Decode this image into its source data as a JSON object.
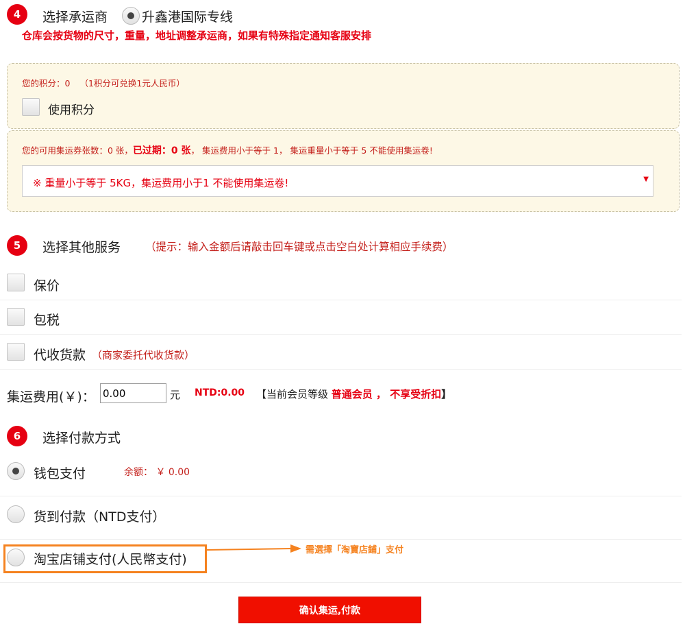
{
  "step4": {
    "number": "4",
    "title": "选择承运商",
    "carrier_option": "升鑫港国际专线",
    "warning": "仓库会按货物的尺寸，重量，地址调整承运商，如果有特殊指定通知客服安排"
  },
  "points": {
    "label": "您的积分：0",
    "rule": "（1积分可兑换1元人民币）",
    "use_label": "使用积分"
  },
  "coupons": {
    "prefix": "您的可用集运券张数：0 张，",
    "expired": "已过期：0 张",
    "suffix": "，  集运费用小于等于 1，  集运重量小于等于 5 不能使用集运卷!",
    "select_value": "※ 重量小于等于 5KG，集运费用小于1 不能使用集运卷!"
  },
  "step5": {
    "number": "5",
    "title": "选择其他服务",
    "hint": "（提示：输入金额后请敲击回车键或点击空白处计算相应手续费）",
    "services": [
      {
        "label": "保价",
        "note": ""
      },
      {
        "label": "包税",
        "note": ""
      },
      {
        "label": "代收货款",
        "note": "（商家委托代收货款）"
      }
    ]
  },
  "fee": {
    "label": "集运费用(￥)：",
    "value": "0.00",
    "unit": "元",
    "ntd": "NTD:0.00",
    "member_prefix": "【当前会员等级 ",
    "member_level": "普通会员 ，",
    "member_discount": " 不享受折扣",
    "member_suffix": "】"
  },
  "step6": {
    "number": "6",
    "title": "选择付款方式",
    "wallet": {
      "label": "钱包支付",
      "balance": "余额： ￥ 0.00",
      "selected": true
    },
    "cod": {
      "label": "货到付款（NTD支付）",
      "selected": false
    },
    "taobao": {
      "label": "淘宝店铺支付(人民幣支付)",
      "selected": false
    },
    "annotation": "需選擇「淘寶店鋪」支付"
  },
  "submit_label": "确认集运,付款",
  "colors": {
    "accent_red": "#e60012",
    "annotation_orange": "#f5821f",
    "notice_bg": "#fdf8e6"
  }
}
